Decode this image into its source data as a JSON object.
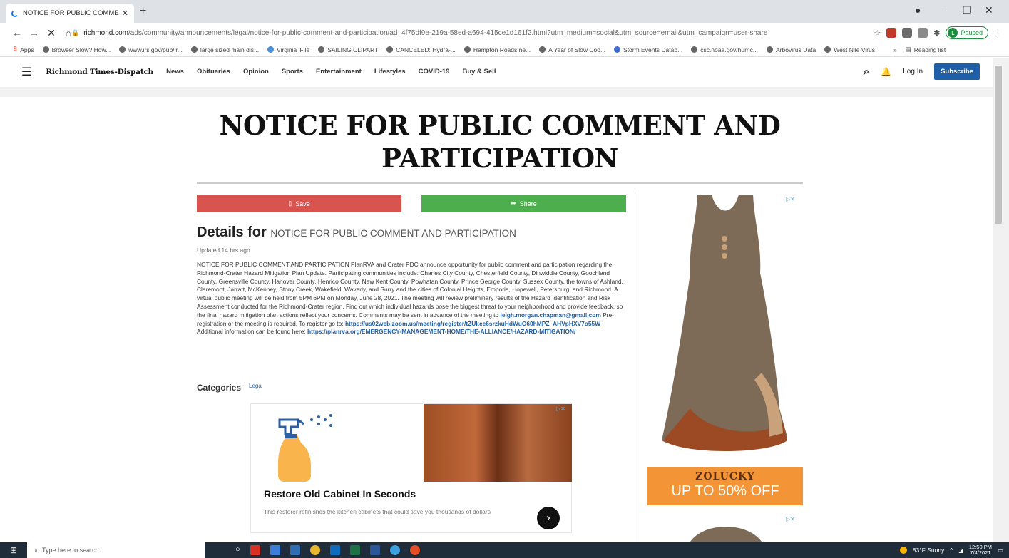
{
  "browser": {
    "tab_title": "NOTICE FOR PUBLIC COMMENT",
    "url_host": "richmond.com",
    "url_path": "/ads/community/announcements/legal/notice-for-public-comment-and-participation/ad_4f75df9e-219a-58ed-a694-415ce1d161f2.html?utm_medium=social&utm_source=email&utm_campaign=user-share",
    "profile_status": "Paused",
    "profile_initial": "L",
    "reading_list": "Reading list",
    "bookmarks": [
      "Apps",
      "Browser Slow? How...",
      "www.irs.gov/pub/ir...",
      "large sized main dis...",
      "Virginia iFile",
      "SAILING CLIPART",
      "CANCELED: Hydra-...",
      "Hampton Roads ne...",
      "A Year of Slow Coo...",
      "Storm Events Datab...",
      "csc.noaa.gov/hurric...",
      "Arbovirus Data",
      "West Nile Virus"
    ]
  },
  "site": {
    "logo": "Richmond Times-Dispatch",
    "nav": [
      "News",
      "Obituaries",
      "Opinion",
      "Sports",
      "Entertainment",
      "Lifestyles",
      "COVID-19",
      "Buy & Sell"
    ],
    "login": "Log In",
    "subscribe": "Subscribe"
  },
  "article": {
    "headline": "NOTICE FOR PUBLIC COMMENT AND PARTICIPATION",
    "save_label": "Save",
    "share_label": "Share",
    "details_prefix": "Details for",
    "details_title": "NOTICE FOR PUBLIC COMMENT AND PARTICIPATION",
    "updated": "Updated 14 hrs ago",
    "body_1": "NOTICE FOR PUBLIC COMMENT AND PARTICIPATION PlanRVA and Crater PDC announce opportunity for public comment and participation regarding the Richmond-Crater Hazard Mitigation Plan Update. Participating communities include: Charles City County, Chesterfield County, Dinwiddie County, Goochland County, Greensville County, Hanover County, Henrico County, New Kent County, Powhatan County, Prince George County, Sussex County, the towns of Ashland, Claremont, Jarratt, McKenney, Stony Creek, Wakefield, Waverly, and Surry and the cities of Colonial Heights, Emporia, Hopewell, Petersburg, and Richmond. A virtual public meeting will be held from 5PM 6PM on Monday, June 28, 2021. The meeting will review preliminary results of the Hazard Identification and Risk Assessment conducted for the Richmond-Crater region. Find out which individual hazards pose the biggest threat to your neighborhood and provide feedback, so the final hazard mitigation plan actions reflect your concerns. Comments may be sent in advance of the meeting to",
    "email": "leigh.morgan.chapman@gmail.com",
    "body_2": "Pre-registration or the meeting is required. To register go to:",
    "register_link": "https://us02web.zoom.us/meeting/register/tZUkce6srzkuHdWuO60hMPZ_AHVpHXV7o55W",
    "body_3": "Additional information can be found here:",
    "info_link": "https://planrva.org/EMERGENCY-MANAGEMENT-HOME/THE-ALLIANCE/HAZARD-MITIGATION/",
    "categories_label": "Categories",
    "category": "Legal"
  },
  "ads": {
    "inline_title": "Restore Old Cabinet In Seconds",
    "inline_desc": "This restorer refinishes the kitchen cabinets that could save you thousands of dollars",
    "side_brand": "ZOLUCKY",
    "side_promo": "UP TO 50% OFF"
  },
  "taskbar": {
    "search_placeholder": "Type here to search",
    "weather": "83°F  Sunny",
    "time": "12:50 PM",
    "date": "7/4/2021"
  }
}
